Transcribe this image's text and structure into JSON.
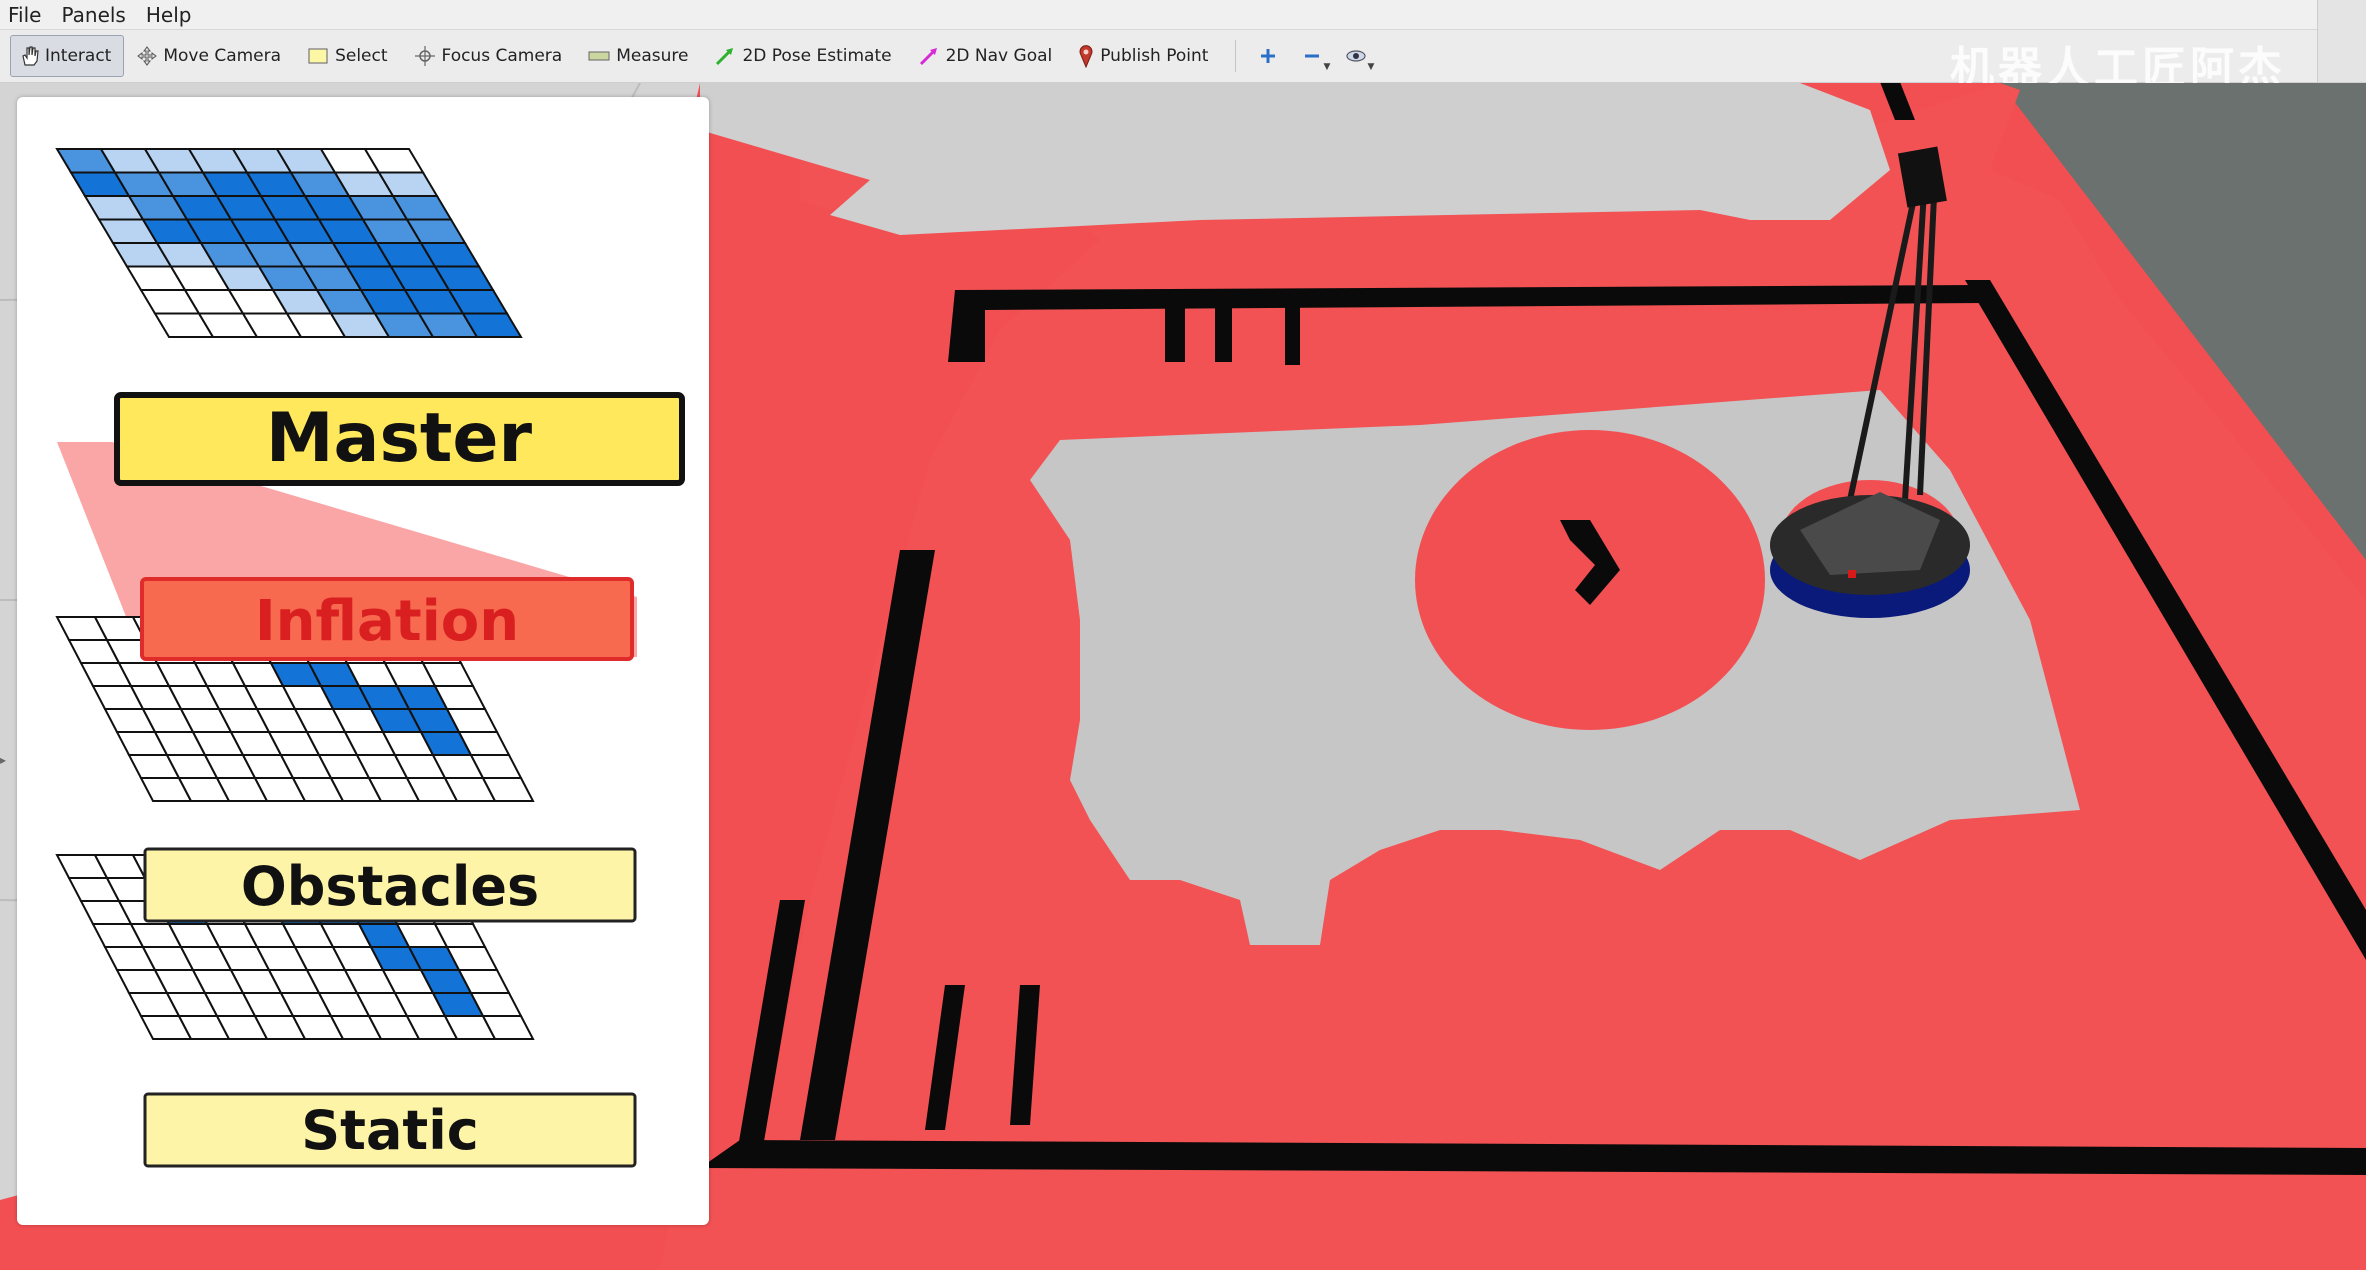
{
  "menubar": {
    "items": [
      {
        "label": "File"
      },
      {
        "label": "Panels"
      },
      {
        "label": "Help"
      }
    ]
  },
  "toolbar": {
    "tools": [
      {
        "label": "Interact",
        "icon": "hand-cursor-icon",
        "active": true
      },
      {
        "label": "Move Camera",
        "icon": "move-arrows-icon",
        "active": false
      },
      {
        "label": "Select",
        "icon": "select-box-icon",
        "active": false
      },
      {
        "label": "Focus Camera",
        "icon": "focus-crosshair-icon",
        "active": false
      },
      {
        "label": "Measure",
        "icon": "ruler-icon",
        "active": false
      },
      {
        "label": "2D Pose Estimate",
        "icon": "green-arrow-icon",
        "active": false
      },
      {
        "label": "2D Nav Goal",
        "icon": "magenta-arrow-icon",
        "active": false
      },
      {
        "label": "Publish Point",
        "icon": "map-pin-icon",
        "active": false
      }
    ],
    "extra_icons": [
      "add-icon",
      "remove-icon",
      "eye-icon"
    ]
  },
  "watermark": "机器人工匠阿杰",
  "diagram": {
    "layers": [
      {
        "label": "Master",
        "color": "#ffe85c"
      },
      {
        "label": "Inflation",
        "color": "#f76a4f"
      },
      {
        "label": "Obstacles",
        "color": "#fdf4a8"
      },
      {
        "label": "Static",
        "color": "#fdf4a8"
      }
    ],
    "cell_colors": {
      "dark_blue": "#1473d6",
      "mid_blue": "#4a93df",
      "light_blue": "#b8d4f2",
      "white": "#ffffff"
    }
  },
  "viewport": {
    "colors": {
      "costmap_red": "#f24f52",
      "floor_gray": "#c8c8c8",
      "obstacle_black": "#0a0a0a",
      "unknown_dark": "#6a716f"
    }
  }
}
